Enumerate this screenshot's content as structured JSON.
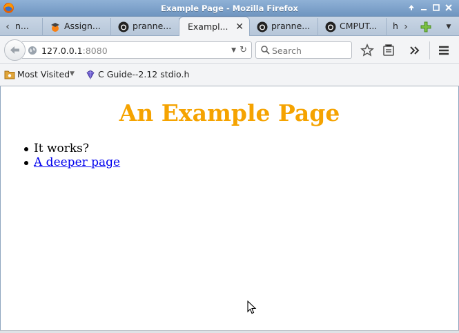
{
  "window": {
    "title": "Example Page - Mozilla Firefox"
  },
  "tabs": [
    {
      "label": "n...",
      "icon": "globe-icon"
    },
    {
      "label": "Assign...",
      "icon": "moodle-icon"
    },
    {
      "label": "pranne...",
      "icon": "github-icon"
    },
    {
      "label": "Exampl...",
      "icon": "none",
      "active": true
    },
    {
      "label": "pranne...",
      "icon": "github-icon"
    },
    {
      "label": "CMPUT...",
      "icon": "github-icon"
    },
    {
      "label": "h",
      "icon": "none"
    }
  ],
  "navbar": {
    "url_host": "127.0.0.1",
    "url_port": ":8080",
    "search_placeholder": "Search"
  },
  "bookmarks": [
    {
      "label": "Most Visited",
      "icon": "folder-icon",
      "dropdown": true
    },
    {
      "label": "C Guide--2.12 stdio.h",
      "icon": "gem-icon"
    }
  ],
  "page": {
    "heading": "An Example Page",
    "heading_color": "#f5a300",
    "items": [
      {
        "text": "It works?",
        "link": false
      },
      {
        "text": "A deeper page",
        "link": true
      }
    ]
  }
}
